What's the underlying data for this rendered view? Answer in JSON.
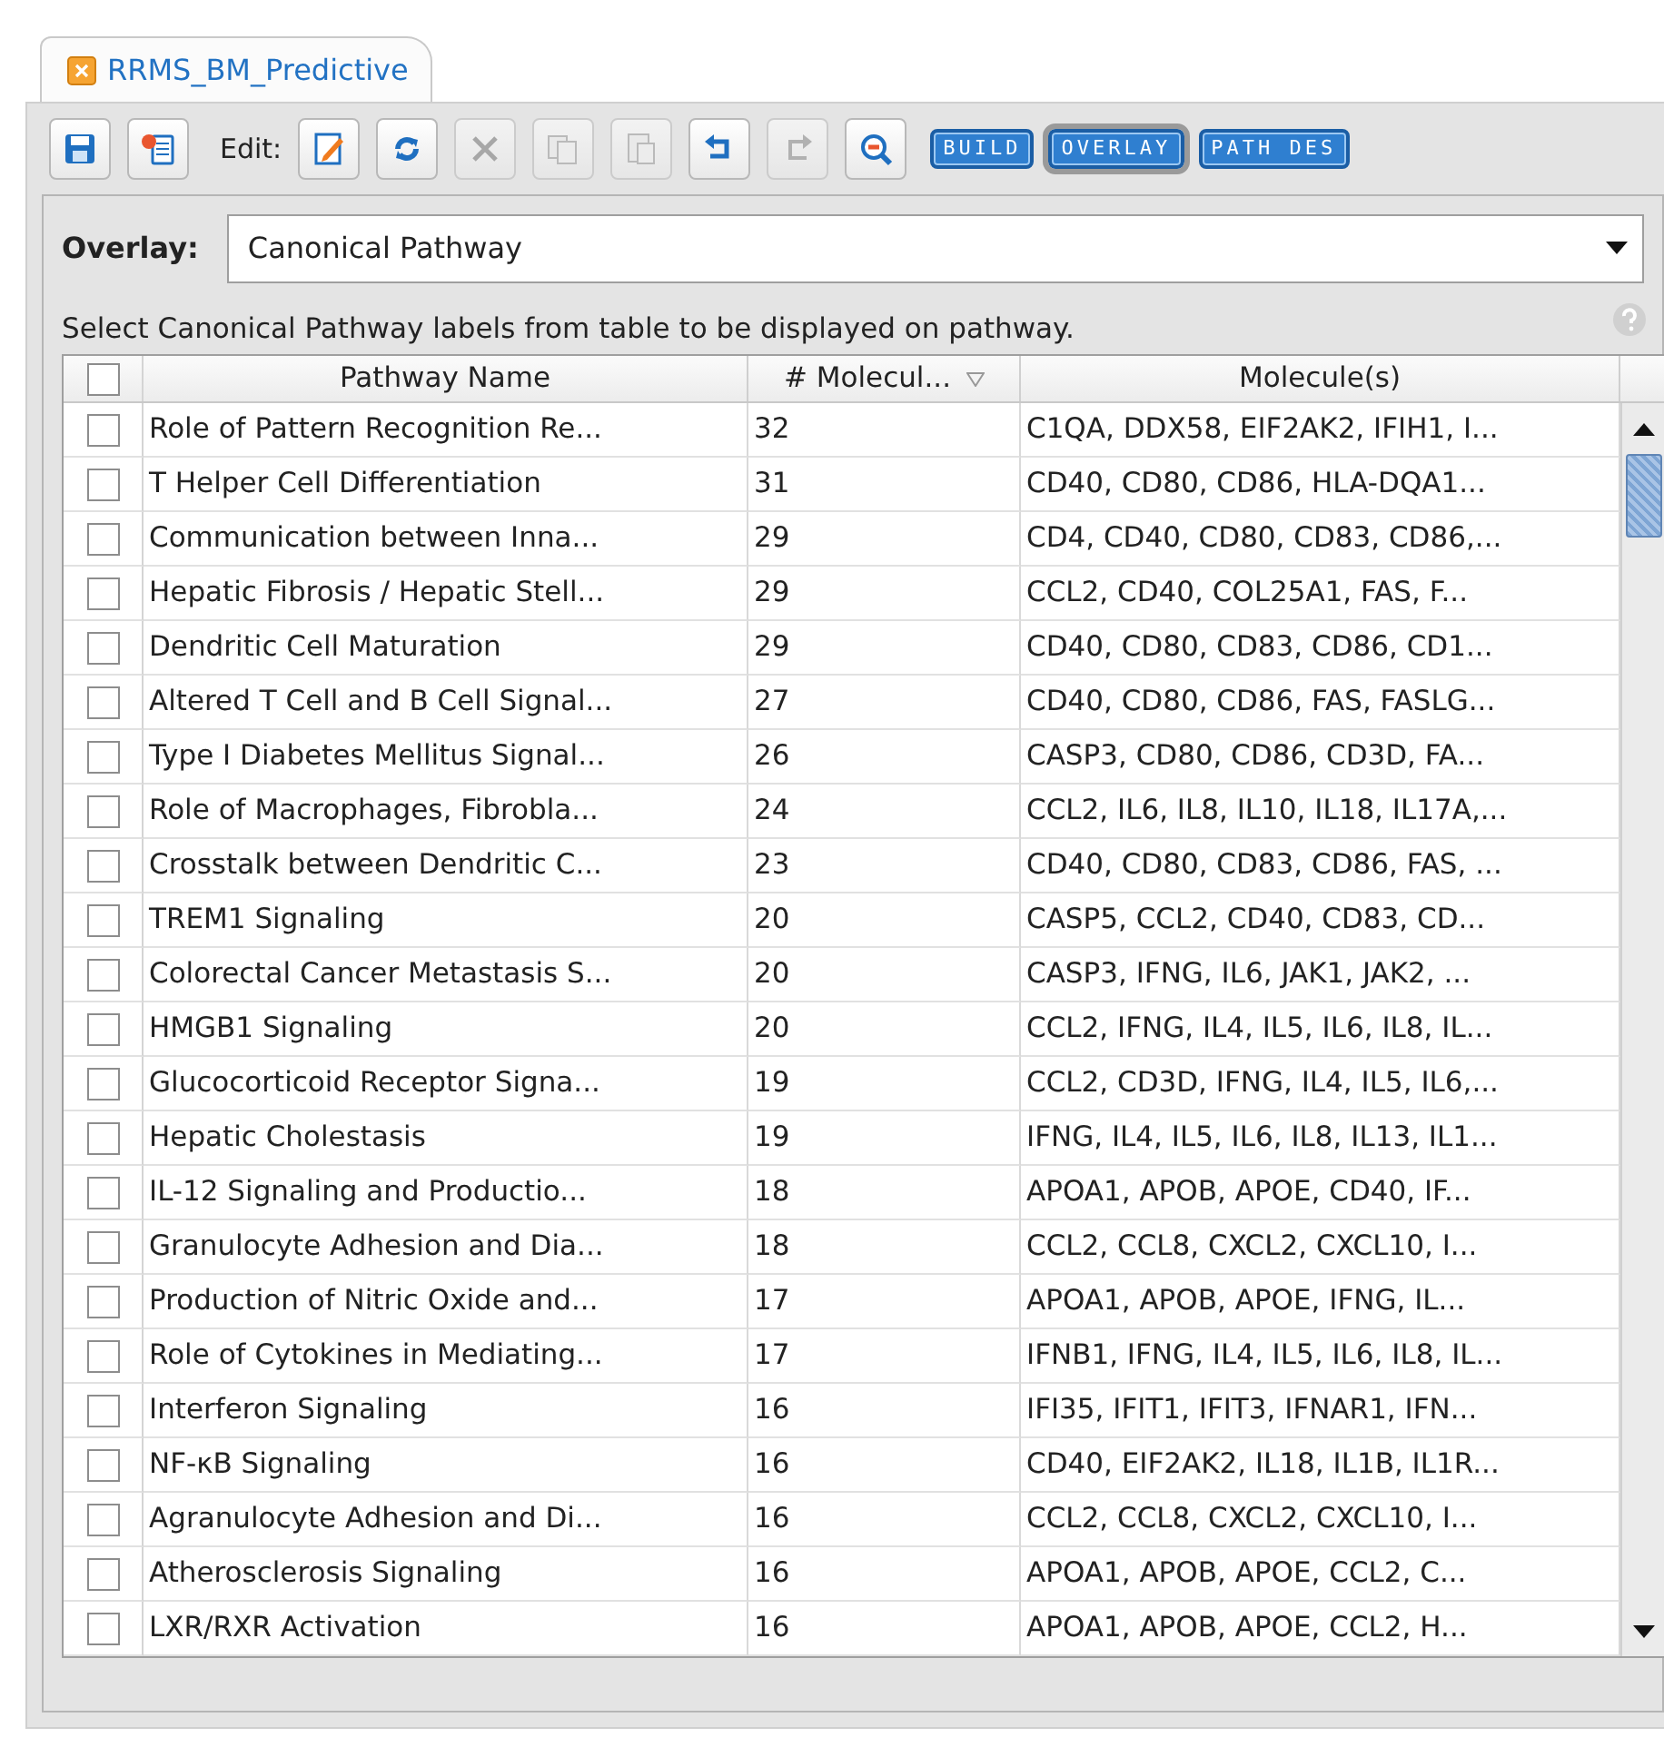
{
  "tab": {
    "title": "RRMS_BM_Predictive",
    "selected": true
  },
  "toolbar": {
    "edit_label": "Edit:",
    "tools": [
      {
        "kind": "save",
        "disabled": false
      },
      {
        "kind": "export",
        "disabled": false
      },
      {
        "kind": "label"
      },
      {
        "kind": "edit",
        "disabled": false
      },
      {
        "kind": "refresh",
        "disabled": false
      },
      {
        "kind": "delete",
        "disabled": true
      },
      {
        "kind": "copy",
        "disabled": true
      },
      {
        "kind": "paste",
        "disabled": true
      },
      {
        "kind": "undo",
        "disabled": false
      },
      {
        "kind": "redo",
        "disabled": true
      },
      {
        "kind": "zoom",
        "disabled": false
      }
    ],
    "modes": [
      {
        "label": "BUILD",
        "selected": false
      },
      {
        "label": "OVERLAY",
        "selected": true
      },
      {
        "label": "PATH DES",
        "selected": false
      }
    ]
  },
  "overlay": {
    "label": "Overlay:",
    "value": "Canonical Pathway"
  },
  "hint": "Select Canonical Pathway labels from table to be displayed on pathway.",
  "table": {
    "select_all_checked": false,
    "columns": [
      "Pathway Name",
      "# Molecul...",
      "Molecule(s)"
    ],
    "rows": [
      {
        "checked": false,
        "name": "Role of Pattern Recognition Re...",
        "count": "32",
        "molecules": "C1QA, DDX58, EIF2AK2, IFIH1, I..."
      },
      {
        "checked": false,
        "name": "T Helper Cell Differentiation",
        "count": "31",
        "molecules": "CD40, CD80, CD86, HLA-DQA1..."
      },
      {
        "checked": false,
        "name": "Communication between Inna...",
        "count": "29",
        "molecules": "CD4, CD40, CD80, CD83, CD86,..."
      },
      {
        "checked": false,
        "name": "Hepatic Fibrosis / Hepatic Stell...",
        "count": "29",
        "molecules": "CCL2, CD40, COL25A1, FAS, F..."
      },
      {
        "checked": false,
        "name": "Dendritic Cell Maturation",
        "count": "29",
        "molecules": "CD40, CD80, CD83, CD86, CD1..."
      },
      {
        "checked": false,
        "name": "Altered T Cell and B Cell Signal...",
        "count": "27",
        "molecules": "CD40, CD80, CD86, FAS, FASLG..."
      },
      {
        "checked": false,
        "name": "Type I Diabetes Mellitus Signal...",
        "count": "26",
        "molecules": "CASP3, CD80, CD86, CD3D, FA..."
      },
      {
        "checked": false,
        "name": "Role of Macrophages, Fibrobla...",
        "count": "24",
        "molecules": "CCL2, IL6, IL8, IL10, IL18, IL17A,..."
      },
      {
        "checked": false,
        "name": "Crosstalk between Dendritic C...",
        "count": "23",
        "molecules": "CD40, CD80, CD83, CD86, FAS, ..."
      },
      {
        "checked": false,
        "name": "TREM1 Signaling",
        "count": "20",
        "molecules": "CASP5, CCL2, CD40, CD83, CD..."
      },
      {
        "checked": false,
        "name": "Colorectal Cancer Metastasis S...",
        "count": "20",
        "molecules": "CASP3, IFNG, IL6, JAK1, JAK2, ..."
      },
      {
        "checked": false,
        "name": "HMGB1 Signaling",
        "count": "20",
        "molecules": "CCL2, IFNG, IL4, IL5, IL6, IL8, IL..."
      },
      {
        "checked": false,
        "name": "Glucocorticoid Receptor Signa...",
        "count": "19",
        "molecules": "CCL2, CD3D, IFNG, IL4, IL5, IL6,..."
      },
      {
        "checked": false,
        "name": "Hepatic Cholestasis",
        "count": "19",
        "molecules": "IFNG, IL4, IL5, IL6, IL8, IL13, IL1..."
      },
      {
        "checked": false,
        "name": "IL-12 Signaling and Productio...",
        "count": "18",
        "molecules": "APOA1, APOB, APOE, CD40, IF..."
      },
      {
        "checked": false,
        "name": "Granulocyte Adhesion and Dia...",
        "count": "18",
        "molecules": "CCL2, CCL8, CXCL2, CXCL10, I..."
      },
      {
        "checked": false,
        "name": "Production of Nitric Oxide and...",
        "count": "17",
        "molecules": "APOA1, APOB, APOE, IFNG, IL..."
      },
      {
        "checked": false,
        "name": "Role of Cytokines in Mediating...",
        "count": "17",
        "molecules": "IFNB1, IFNG, IL4, IL5, IL6, IL8, IL..."
      },
      {
        "checked": false,
        "name": "Interferon Signaling",
        "count": "16",
        "molecules": "IFI35, IFIT1, IFIT3, IFNAR1, IFN..."
      },
      {
        "checked": false,
        "name": "NF-κB Signaling",
        "count": "16",
        "molecules": "CD40, EIF2AK2, IL18, IL1B, IL1R..."
      },
      {
        "checked": false,
        "name": "Agranulocyte Adhesion and Di...",
        "count": "16",
        "molecules": "CCL2, CCL8, CXCL2, CXCL10, I..."
      },
      {
        "checked": false,
        "name": "Atherosclerosis Signaling",
        "count": "16",
        "molecules": "APOA1, APOB, APOE, CCL2, C..."
      },
      {
        "checked": false,
        "name": "LXR/RXR Activation",
        "count": "16",
        "molecules": "APOA1, APOB, APOE, CCL2, H..."
      }
    ]
  }
}
